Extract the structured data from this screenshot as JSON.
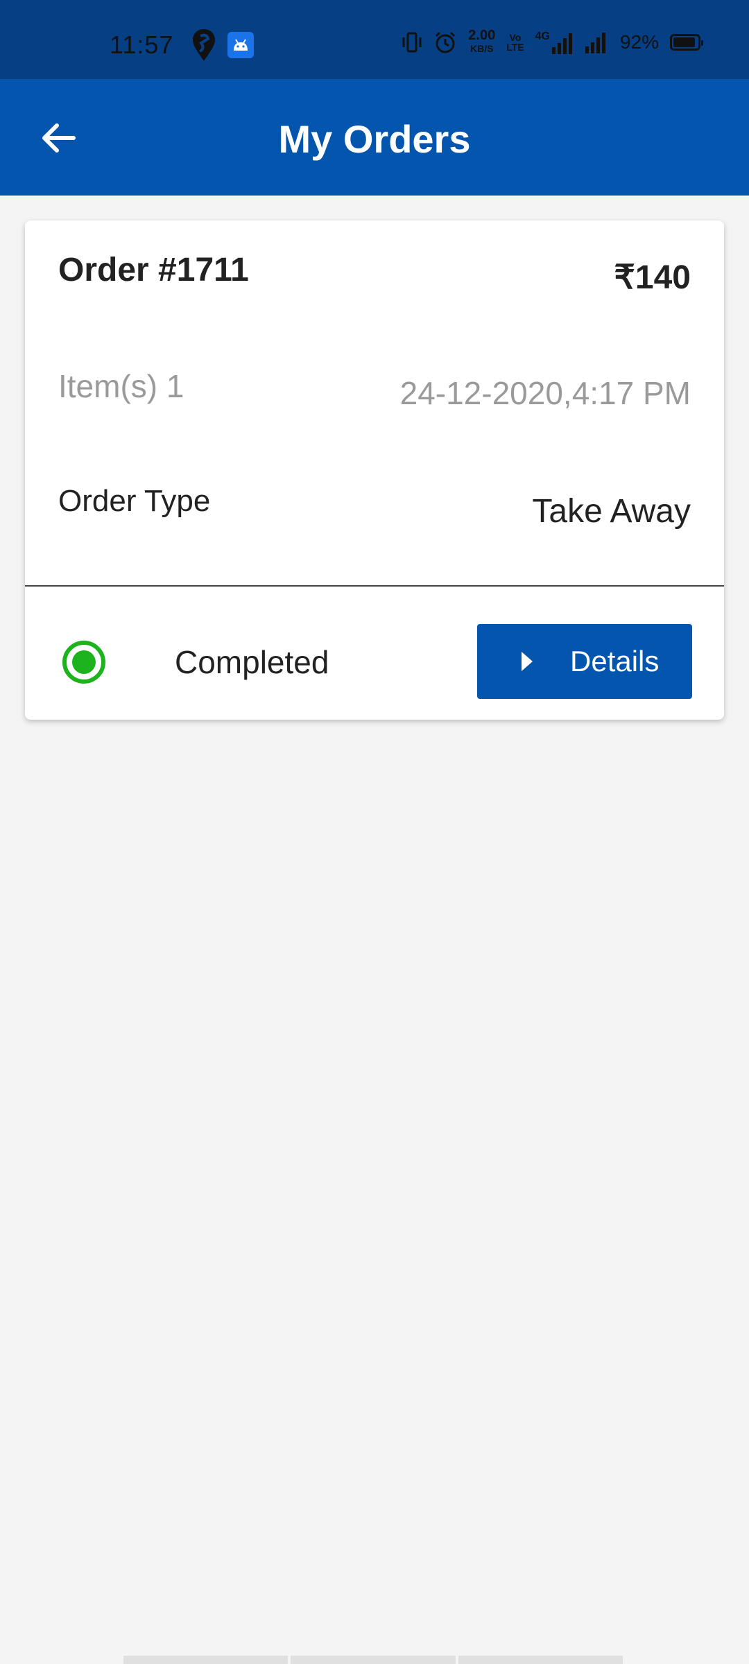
{
  "status_bar": {
    "time": "11:57",
    "net_speed": "2.00",
    "net_speed_unit": "KB/S",
    "volte": "Vo\nLTE",
    "network": "4G",
    "battery": "92%",
    "icons": [
      "swiggy-icon",
      "android-app-icon",
      "vibrate-icon",
      "alarm-icon",
      "signal-icon",
      "signal-icon-2",
      "battery-icon"
    ]
  },
  "header": {
    "title": "My Orders",
    "back_icon": "arrow-left-icon"
  },
  "order": {
    "number": "Order #1711",
    "amount": "₹140",
    "items": "Item(s) 1",
    "datetime": "24-12-2020,4:17 PM",
    "type_label": "Order Type",
    "type_value": "Take Away",
    "status": "Completed",
    "details_label": "Details"
  },
  "colors": {
    "primary": "#0455ad",
    "status_bar": "#063f84",
    "status_completed": "#1db31d",
    "background": "#f4f4f4"
  }
}
